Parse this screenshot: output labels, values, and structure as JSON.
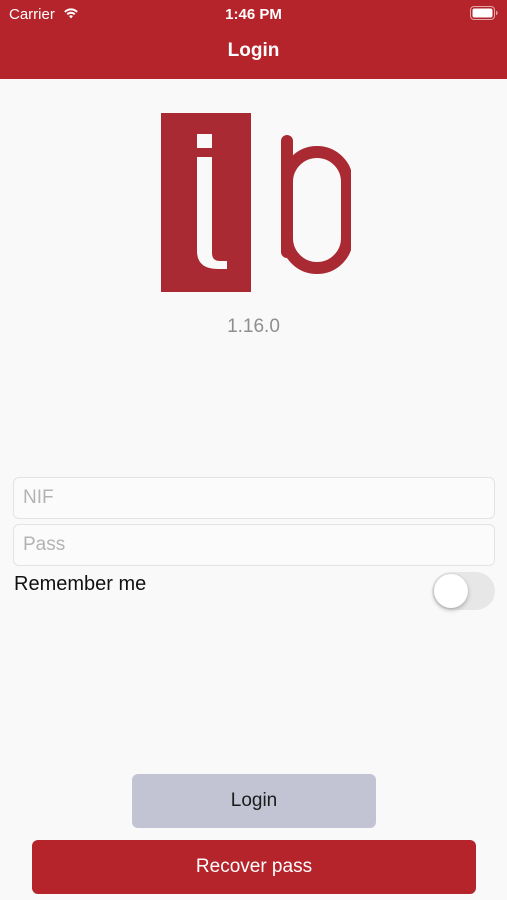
{
  "status_bar": {
    "carrier": "Carrier",
    "time": "1:46 PM",
    "wifi_icon": "wifi-icon",
    "battery_icon": "battery-full-icon"
  },
  "nav": {
    "title": "Login"
  },
  "logo": {
    "name": "ib-logo",
    "text": "ib"
  },
  "app_version": "1.16.0",
  "form": {
    "nif": {
      "placeholder": "NIF",
      "value": ""
    },
    "pass": {
      "placeholder": "Pass",
      "value": ""
    },
    "remember_me": {
      "label": "Remember me",
      "on": false
    }
  },
  "buttons": {
    "login": "Login",
    "recover": "Recover pass"
  },
  "colors": {
    "brand_red": "#b5232b",
    "logo_red": "#a92a33",
    "login_button_bg": "#c2c4d4",
    "background": "#f9f9f9"
  }
}
